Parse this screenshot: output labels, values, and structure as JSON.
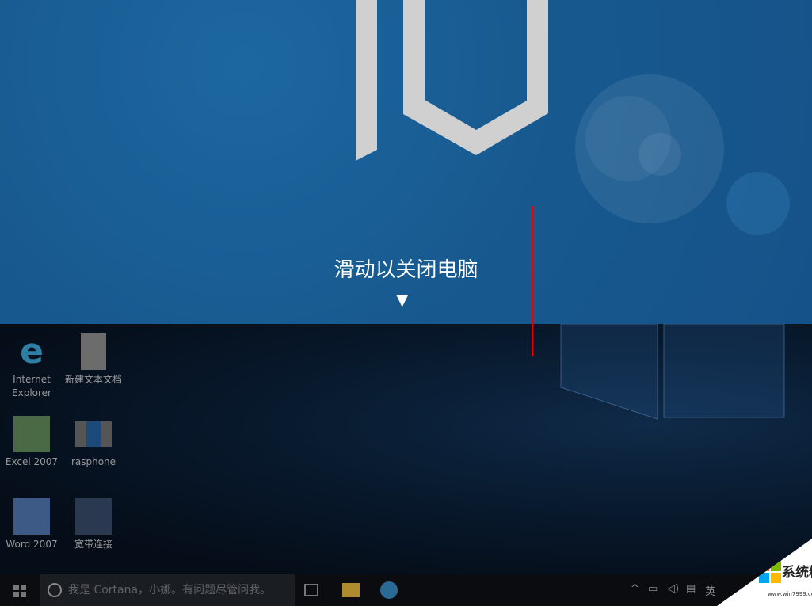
{
  "slide": {
    "text": "滑动以关闭电脑",
    "arrow": "▼"
  },
  "desktop_icons": [
    {
      "label1": "Internet",
      "label2": "Explorer",
      "icon": "ie-icon"
    },
    {
      "label1": "新建文本文档",
      "icon": "text-document-icon"
    },
    {
      "label1": "Excel 2007",
      "icon": "excel-icon"
    },
    {
      "label1": "rasphone",
      "icon": "rasphone-icon"
    },
    {
      "label1": "Word 2007",
      "icon": "word-icon"
    },
    {
      "label1": "宽带连接",
      "icon": "network-icon"
    }
  ],
  "taskbar": {
    "search_placeholder": "我是 Cortana，小娜。有问题尽管问我。",
    "tray_lang": "英"
  },
  "watermark": {
    "text": "系统粉",
    "url": "www.win7999.com"
  },
  "colors": {
    "slide_bg": "#17598f",
    "annotation": "#e00000"
  }
}
